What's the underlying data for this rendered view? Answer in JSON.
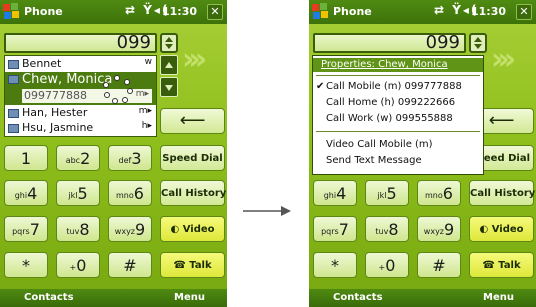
{
  "left": {
    "title": "Phone",
    "time": "11:30",
    "number": "099",
    "contacts": [
      {
        "name": "Bennet",
        "tag": "w"
      },
      {
        "name": "Chew, Monica",
        "tag": "",
        "number": "099777888",
        "num_tag": "m"
      },
      {
        "name": "Han, Hester",
        "tag": "m"
      },
      {
        "name": "Hsu, Jasmine",
        "tag": "h"
      }
    ]
  },
  "right": {
    "title": "Phone",
    "time": "11:30",
    "number": "099",
    "menu": {
      "header": "Properties: Chew, Monica",
      "items": [
        {
          "label": "Call Mobile (m) 099777888",
          "checked": true
        },
        {
          "label": "Call Home (h) 099222666",
          "checked": false
        },
        {
          "label": "Call Work (w) 099555888",
          "checked": false
        },
        {
          "label": "Video Call Mobile (m)",
          "checked": false
        },
        {
          "label": "Send Text Message",
          "checked": false
        }
      ]
    },
    "speed_dial_partial": "eed Dial"
  },
  "keypad": [
    {
      "small": "",
      "big": "1"
    },
    {
      "small": "abc",
      "big": "2"
    },
    {
      "small": "def",
      "big": "3"
    },
    {
      "small": "ghi",
      "big": "4"
    },
    {
      "small": "jkl",
      "big": "5"
    },
    {
      "small": "mno",
      "big": "6"
    },
    {
      "small": "pqrs",
      "big": "7"
    },
    {
      "small": "tuv",
      "big": "8"
    },
    {
      "small": "wxyz",
      "big": "9"
    },
    {
      "small": "",
      "big": "*"
    },
    {
      "small": "+",
      "big": "0"
    },
    {
      "small": "",
      "big": "#"
    }
  ],
  "function_keys": {
    "speed_dial": "Speed Dial",
    "call_history": "Call History",
    "video": "Video",
    "talk": "Talk"
  },
  "softkeys": {
    "left": "Contacts",
    "right": "Menu"
  },
  "colors": {
    "theme_green": "#8fbf1c",
    "titlebar": "#3d720a",
    "highlight": "#5f9416"
  }
}
